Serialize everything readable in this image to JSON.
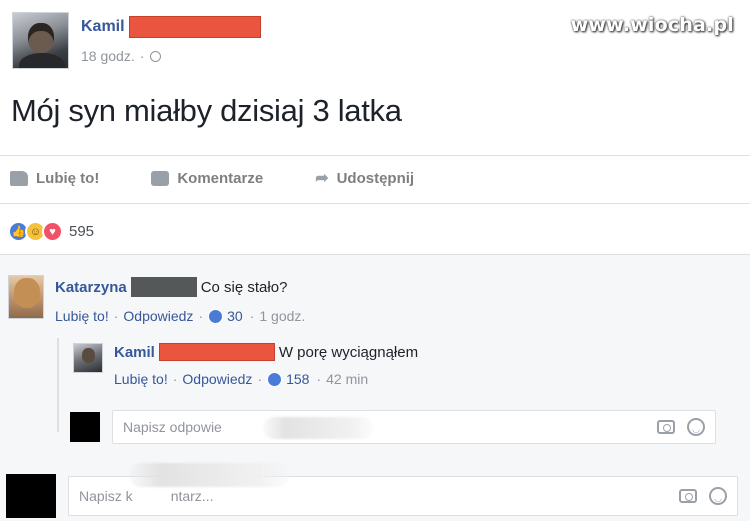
{
  "watermark": "www.wiocha.pl",
  "post": {
    "author": "Kamil",
    "time": "18 godz.",
    "separator": "·",
    "text": "Mój syn miałby dzisiaj 3 latka"
  },
  "actions": {
    "like": "Lubię to!",
    "comment": "Komentarze",
    "share": "Udostępnij"
  },
  "reactions": {
    "count": "595",
    "types": [
      "like",
      "haha",
      "love"
    ]
  },
  "comments": [
    {
      "name": "Katarzyna",
      "text": "Co się stało?",
      "like_label": "Lubię to!",
      "reply_label": "Odpowiedz",
      "likes": "30",
      "time": "1 godz."
    },
    {
      "name": "Kamil",
      "text": "W porę wyciągnąłem",
      "like_label": "Lubię to!",
      "reply_label": "Odpowiedz",
      "likes": "158",
      "time": "42 min"
    }
  ],
  "reply_input": {
    "placeholder": "Napisz odpowie"
  },
  "comment_input": {
    "placeholder_start": "Napisz k",
    "placeholder_end": "ntarz..."
  },
  "colors": {
    "link": "#365899",
    "redaction_red": "#e9553f",
    "redaction_gray": "#555859",
    "like_blue": "#4a7bd6"
  }
}
